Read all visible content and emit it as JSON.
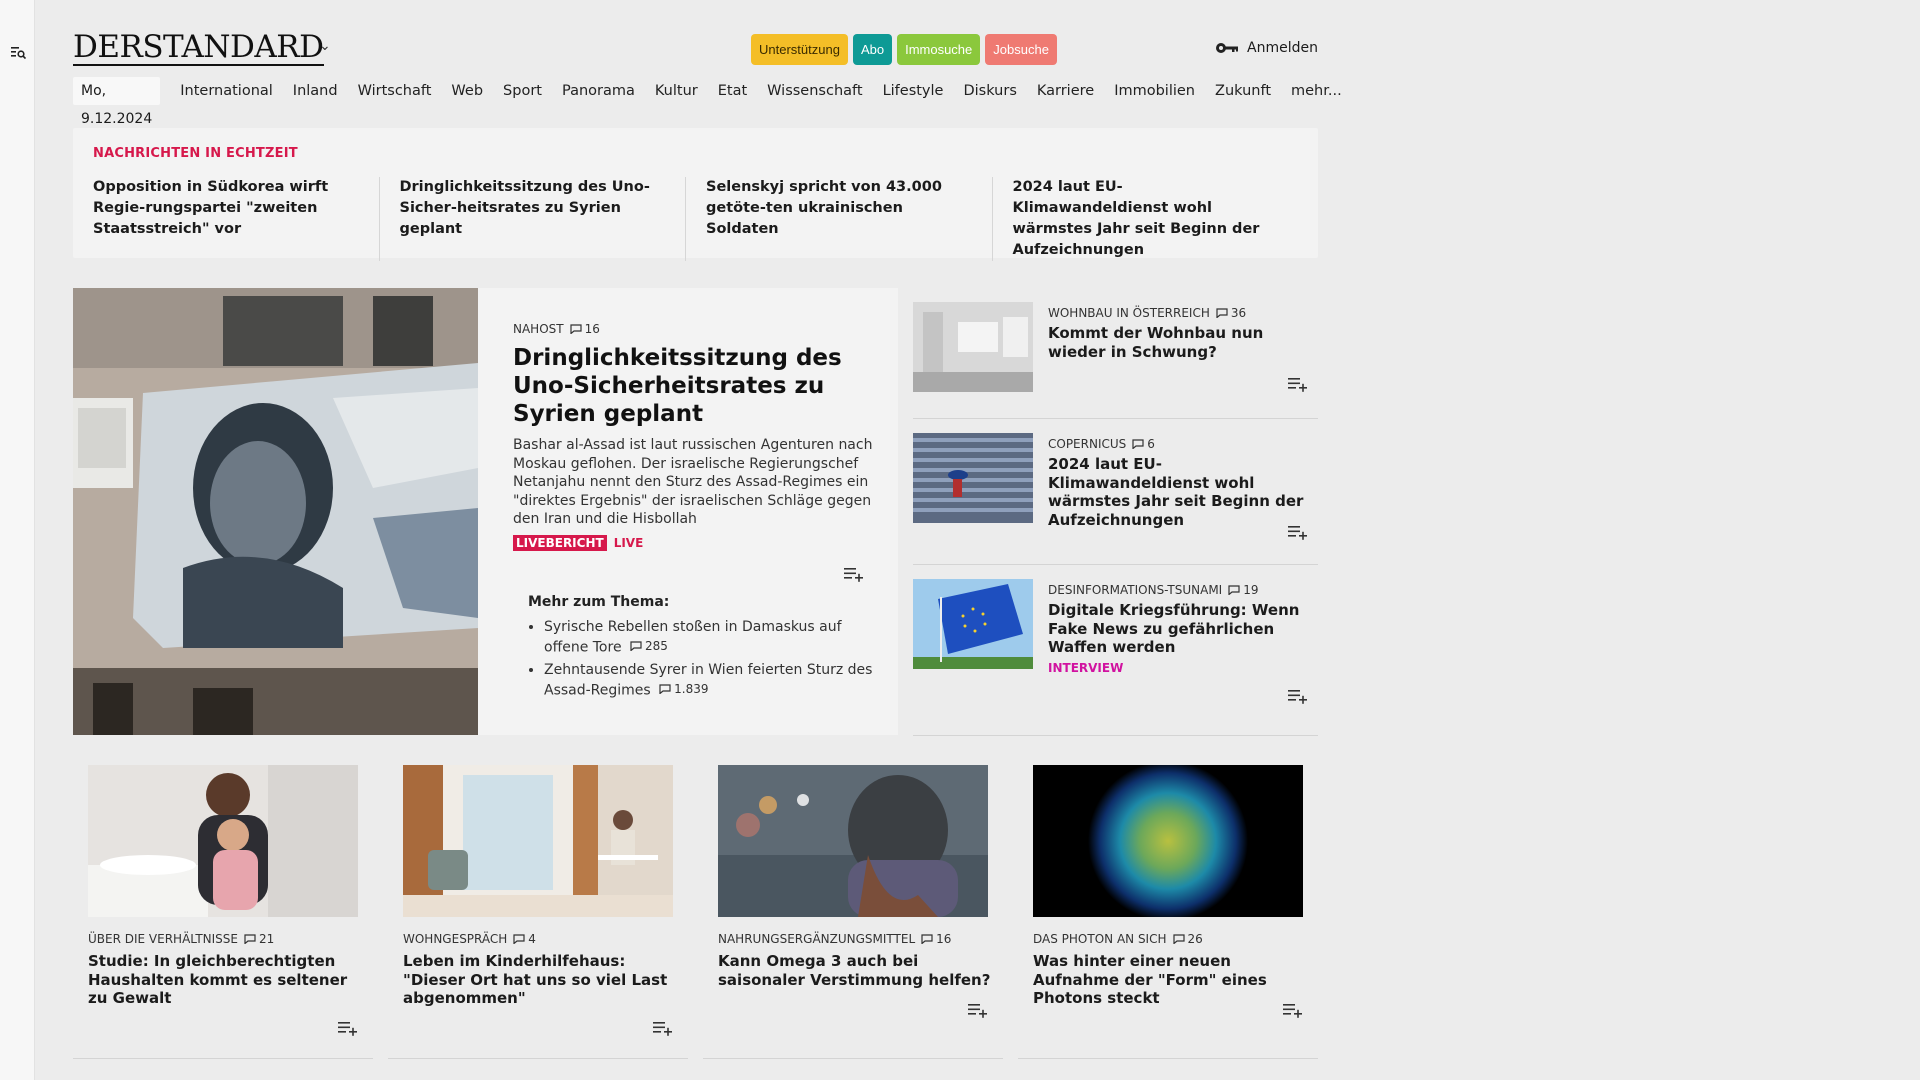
{
  "brand": {
    "logo": "DERSTANDARD"
  },
  "header": {
    "pills": [
      "Unterstützung",
      "Abo",
      "Immosuche",
      "Jobsuche"
    ],
    "login_label": "Anmelden"
  },
  "nav": {
    "date": "Mo, 9.12.2024",
    "items": [
      "International",
      "Inland",
      "Wirtschaft",
      "Web",
      "Sport",
      "Panorama",
      "Kultur",
      "Etat",
      "Wissenschaft",
      "Lifestyle",
      "Diskurs",
      "Karriere",
      "Immobilien",
      "Zukunft",
      "mehr..."
    ]
  },
  "breaking": {
    "label": "NACHRICHTEN IN ECHTZEIT",
    "items": [
      "Opposition in Südkorea wirft Regie-rungspartei \"zweiten Staatsstreich\" vor",
      "Dringlichkeitssitzung des Uno-Sicher-heitsrates zu Syrien geplant",
      "Selenskyj spricht von 43.000 getöte-ten ukrainischen Soldaten",
      "2024 laut EU-Klimawandeldienst wohl wärmstes Jahr seit Beginn der Aufzeichnungen"
    ]
  },
  "lead": {
    "kicker": "NAHOST",
    "comments": "16",
    "title": "Dringlichkeitssitzung des Uno-Sicherheitsrates zu Syrien geplant",
    "teaser": "Bashar al-Assad ist laut russischen Agenturen nach Moskau geflohen. Der israelische Regierungschef Netanjahu nennt den Sturz des Assad-Regimes ein \"direktes Ergebnis\" der israelischen Schläge gegen den Iran und die Hisbollah",
    "badge": "LIVEBERICHT",
    "live": "LIVE",
    "more_label": "Mehr zum Thema:",
    "more": [
      {
        "text": "Syrische Rebellen stoßen in Damaskus auf offene Tore",
        "comments": "285"
      },
      {
        "text": "Zehntausende Syrer in Wien feierten Sturz des Assad-Regimes",
        "comments": "1.839"
      }
    ]
  },
  "side": [
    {
      "kicker": "WOHNBAU IN ÖSTERREICH",
      "comments": "36",
      "title": "Kommt der Wohnbau nun wieder in Schwung?",
      "tag": ""
    },
    {
      "kicker": "COPERNICUS",
      "comments": "6",
      "title": "2024 laut EU-Klimawandeldienst wohl wärmstes Jahr seit Beginn der Aufzeichnungen",
      "tag": ""
    },
    {
      "kicker": "DESINFORMATIONS-TSUNAMI",
      "comments": "19",
      "title": "Digitale Kriegsführung: Wenn Fake News zu gefährlichen Waffen werden",
      "tag": "INTERVIEW"
    }
  ],
  "cards": [
    {
      "kicker": "ÜBER DIE VERHÄLTNISSE",
      "comments": "21",
      "title": "Studie: In gleichberechtigten Haushalten kommt es seltener zu Gewalt"
    },
    {
      "kicker": "WOHNGESPRÄCH",
      "comments": "4",
      "title": "Leben im Kinderhilfehaus: \"Dieser Ort hat uns so viel Last abgenommen\""
    },
    {
      "kicker": "NAHRUNGSERGÄNZUNGSMITTEL",
      "comments": "16",
      "title": "Kann Omega 3 auch bei saisonaler Verstimmung helfen?"
    },
    {
      "kicker": "DAS PHOTON AN SICH",
      "comments": "26",
      "title": "Was hinter einer neuen Aufnahme der \"Form\" eines Photons steckt"
    }
  ],
  "colors": {
    "accent_red": "#d6184b",
    "interview_pink": "#d112a0",
    "page_bg": "#ececec",
    "card_bg": "#f3f3f3"
  }
}
